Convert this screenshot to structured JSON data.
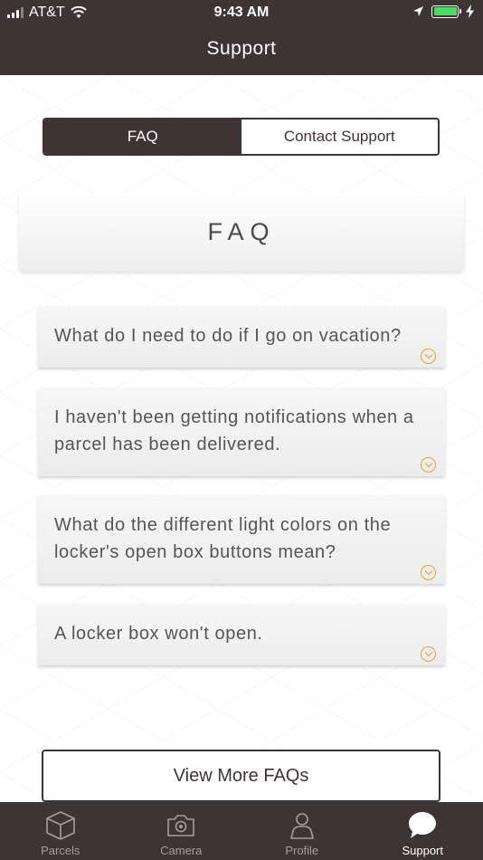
{
  "status_bar": {
    "carrier": "AT&T",
    "time": "9:43 AM"
  },
  "header": {
    "title": "Support"
  },
  "segmented": {
    "faq_label": "FAQ",
    "contact_label": "Contact Support"
  },
  "faq_section": {
    "title": "FAQ",
    "items": [
      {
        "question": "What do I need to do if I go on vacation?"
      },
      {
        "question": "I haven't been getting notifications when a parcel has been delivered."
      },
      {
        "question": "What do the different light colors on the locker's open box buttons mean?"
      },
      {
        "question": "A locker box won't open."
      }
    ]
  },
  "more_button": {
    "label": "View More FAQs"
  },
  "tabbar": {
    "tabs": [
      {
        "label": "Parcels",
        "icon": "box-icon"
      },
      {
        "label": "Camera",
        "icon": "camera-icon"
      },
      {
        "label": "Profile",
        "icon": "person-icon"
      },
      {
        "label": "Support",
        "icon": "chat-bubble-icon"
      }
    ]
  },
  "colors": {
    "brand": "#3e3435",
    "accent": "#e0a536",
    "battery": "#4cd964"
  }
}
